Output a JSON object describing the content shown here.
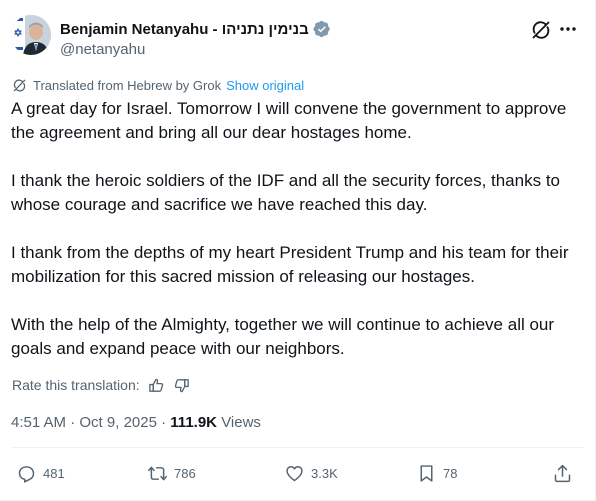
{
  "author": {
    "display_name": "Benjamin Netanyahu - בנימין נתניהו",
    "handle": "@netanyahu"
  },
  "translation": {
    "notice": "Translated from Hebrew by Grok",
    "show_original": "Show original"
  },
  "body": {
    "paragraphs": [
      "A great day for Israel. Tomorrow I will convene the government to approve the agreement and bring all our dear hostages home.",
      "I thank the heroic soldiers of the IDF and all the security forces, thanks to whose courage and sacrifice we have reached this day.",
      "I thank from the depths of my heart President Trump and his team for their mobilization for this sacred mission of releasing our hostages.",
      "With the help of the Almighty, together we will continue to achieve all our goals and expand peace with our neighbors."
    ]
  },
  "rate": {
    "label": "Rate this translation:"
  },
  "meta": {
    "time": "4:51 AM",
    "separator": "·",
    "date": "Oct 9, 2025",
    "views_count": "111.9K",
    "views_label": "Views"
  },
  "actions": {
    "replies": "481",
    "reposts": "786",
    "likes": "3.3K",
    "bookmarks": "78"
  },
  "colors": {
    "text": "#0f1419",
    "muted": "#536471",
    "link": "#1d9bf0",
    "verified": "#829aab",
    "divider": "#eff3f4"
  }
}
